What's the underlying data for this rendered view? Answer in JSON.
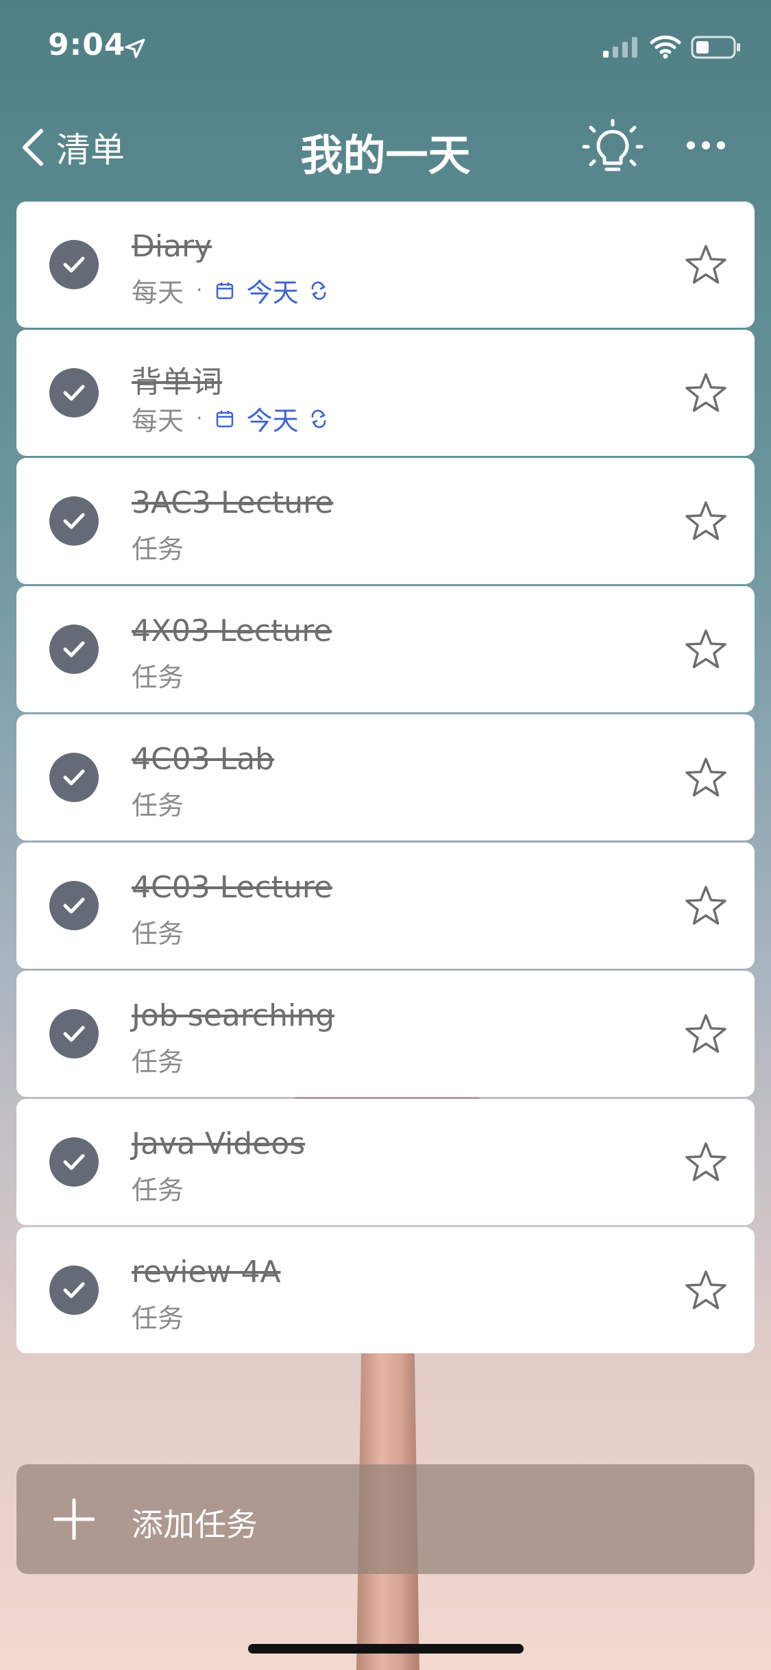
{
  "status_bar": {
    "time": "9:04",
    "icons": [
      "location-arrow-icon",
      "cellular-signal-icon",
      "wifi-icon",
      "battery-icon"
    ]
  },
  "nav": {
    "back_label": "清单",
    "title": "我的一天",
    "icons": [
      "chevron-left-icon",
      "lightbulb-icon",
      "more-icon"
    ]
  },
  "colors": {
    "check": "#656b76",
    "today_accent": "#3b63d6",
    "title_text": "#6e6e70"
  },
  "tasks": [
    {
      "title": "Diary",
      "meta": "每天",
      "due": "今天",
      "repeat": true,
      "completed": true
    },
    {
      "title": "背单词",
      "meta": "每天",
      "due": "今天",
      "repeat": true,
      "completed": true
    },
    {
      "title": "3AC3 Lecture",
      "meta": "任务",
      "completed": true
    },
    {
      "title": "4X03 Lecture",
      "meta": "任务",
      "completed": true
    },
    {
      "title": "4C03 Lab",
      "meta": "任务",
      "completed": true
    },
    {
      "title": "4C03 Lecture",
      "meta": "任务",
      "completed": true
    },
    {
      "title": "Job searching",
      "meta": "任务",
      "completed": true
    },
    {
      "title": "Java Videos",
      "meta": "任务",
      "completed": true
    },
    {
      "title": "review 4A",
      "meta": "任务",
      "completed": true
    }
  ],
  "add_task": {
    "label": "添加任务"
  }
}
